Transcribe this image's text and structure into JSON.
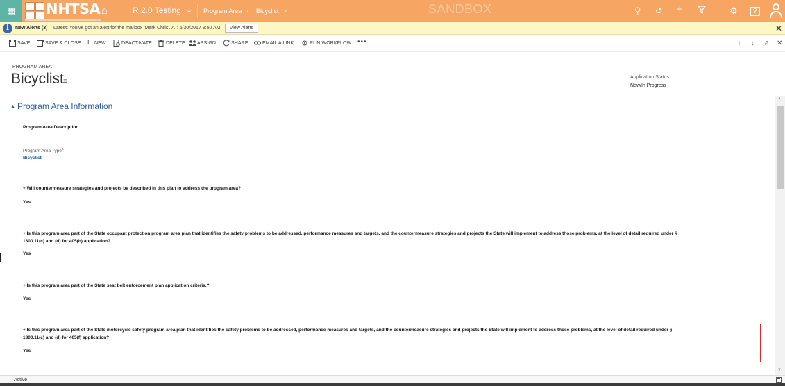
{
  "topnav": {
    "logo_text": "NHTSA",
    "app_name": "R 2.0 Testing",
    "breadcrumb": [
      "Program Area",
      "Bicyclist"
    ],
    "environment": "SANDBOX",
    "colors": {
      "bar": "#f6a563",
      "waffle": "#5cb5a6"
    },
    "icons": [
      "waffle-icon",
      "home-icon",
      "search-icon",
      "history-icon",
      "plus-icon",
      "filter-icon",
      "gear-icon",
      "help-icon",
      "user-icon"
    ],
    "help_label": "?"
  },
  "alert": {
    "title": "New Alerts (3)",
    "message": "Latest: You've got an alert for the mailbox 'Mark Chris'. AT: 5/30/2017 9:50 AM",
    "button": "View Alerts"
  },
  "commands": {
    "save": "SAVE",
    "save_close": "SAVE & CLOSE",
    "new": "NEW",
    "deactivate": "DEACTIVATE",
    "delete": "DELETE",
    "assign": "ASSIGN",
    "share": "SHARE",
    "email_link": "EMAIL A LINK",
    "run_workflow": "RUN WORKFLOW",
    "more": "•••"
  },
  "header": {
    "entity_type": "PROGRAM AREA",
    "title": "Bicyclist",
    "status_label": "Application Status",
    "status_value": "New/In Progress"
  },
  "section": {
    "title": "Program Area Information"
  },
  "form": {
    "description_label": "Program Area Description",
    "type_label": "Program Area Type",
    "required_mark": "*",
    "type_value": "Bicyclist",
    "questions": [
      {
        "text": "+ Will countermeasure strategies and projects be described in this plan to address the program area?",
        "text2": "",
        "answer": "Yes"
      },
      {
        "text": "+ Is this program area part of the State occupant protection program area plan that identifies the safety problems to be addressed, performance measures and targets, and the countermeasure strategies and projects the State will implement to address those problems, at the level of detail required under §",
        "text2": "1300.11(c) and (d) for 405(b) application?",
        "answer": "Yes"
      },
      {
        "text": "+ Is this program area part of the State seat belt enforcement plan application criteria.?",
        "text2": "",
        "answer": "Yes"
      },
      {
        "text": "+ Is this program area part of the State motorcycle safety program area plan that identifies the safety problems to be addressed, performance measures and targets, and the countermeasure strategies and projects the State will implement to address those problems, at the level of detail required under §",
        "text2": "1300.11(c) and (d) for 405(f) application?",
        "answer": "Yes"
      }
    ]
  },
  "footer": {
    "status": "Active"
  }
}
